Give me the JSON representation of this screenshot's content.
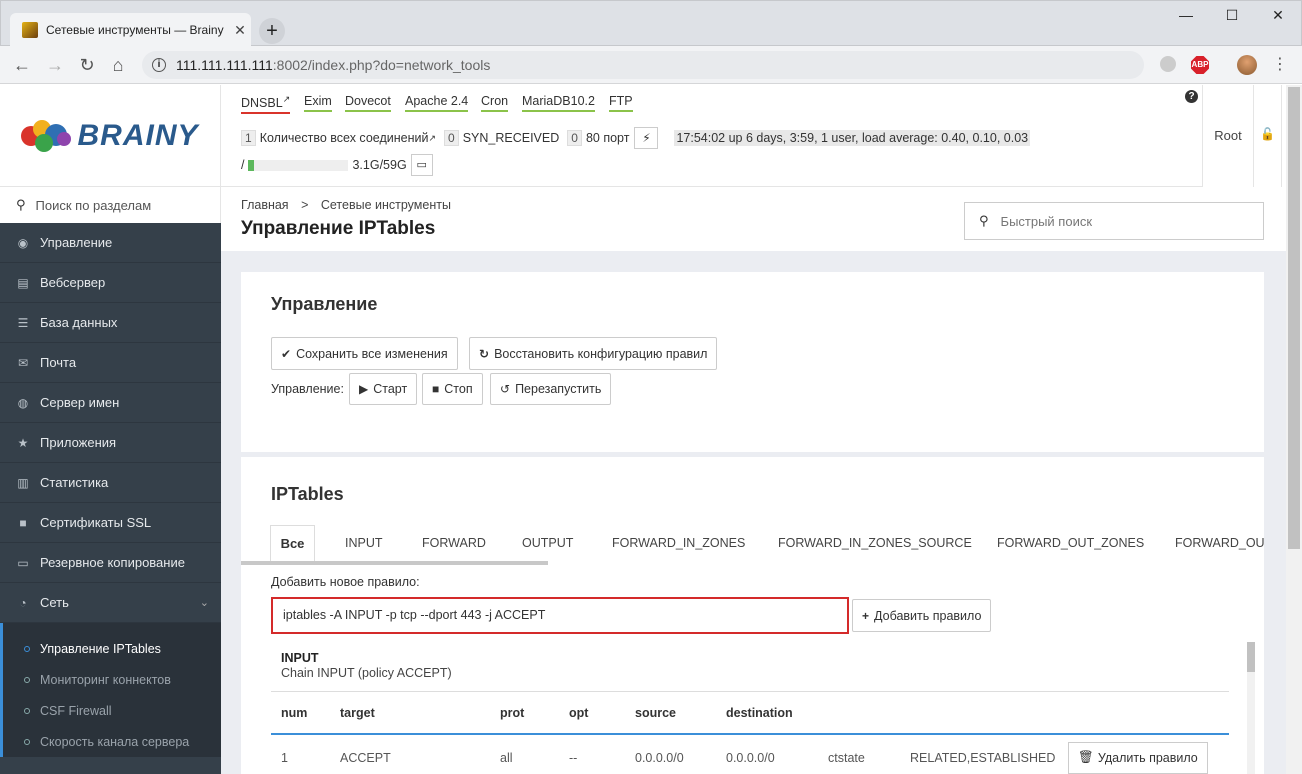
{
  "browser": {
    "tab_title": "Сетевые инструменты — Brainy",
    "tab_close": "✕",
    "new_tab": "+",
    "url_host": "111.111.111.111",
    "url_path": ":8002/index.php?do=network_tools",
    "abp_label": "ABP"
  },
  "logo": {
    "text": "BRAINY"
  },
  "services": [
    "DNSBL",
    "Exim",
    "Dovecot",
    "Apache 2.4",
    "Cron",
    "MariaDB10.2",
    "FTP"
  ],
  "stats": {
    "connections_count": "1",
    "connections_label": "Количество всех соединений",
    "syn_count": "0",
    "syn_label": "SYN_RECEIVED",
    "port_count": "0",
    "port_label": "80 порт",
    "uptime": "17:54:02 up 6 days, 3:59, 1 user, load average: 0.40, 0.10, 0.03",
    "disk_mount": "/",
    "disk_usage": "3.1G/59G",
    "disk_fraction": 0.053
  },
  "user": {
    "name": "Root"
  },
  "sidebar": {
    "search_placeholder": "Поиск по разделам",
    "items": [
      {
        "label": "Управление",
        "icon": "dashboard-icon"
      },
      {
        "label": "Вебсервер",
        "icon": "server-icon"
      },
      {
        "label": "База данных",
        "icon": "database-icon"
      },
      {
        "label": "Почта",
        "icon": "mail-icon"
      },
      {
        "label": "Сервер имен",
        "icon": "globe-icon"
      },
      {
        "label": "Приложения",
        "icon": "star-icon"
      },
      {
        "label": "Статистика",
        "icon": "bar-chart-icon"
      },
      {
        "label": "Сертификаты SSL",
        "icon": "lock-icon"
      },
      {
        "label": "Резервное копирование",
        "icon": "hdd-icon"
      },
      {
        "label": "Сеть",
        "icon": "rss-icon"
      }
    ],
    "subitems": [
      {
        "label": "Управление IPTables"
      },
      {
        "label": "Мониторинг коннектов"
      },
      {
        "label": "CSF Firewall"
      },
      {
        "label": "Скорость канала сервера"
      }
    ]
  },
  "breadcrumb": {
    "home": "Главная",
    "separator": ">",
    "current": "Сетевые инструменты"
  },
  "page_title": "Управление IPTables",
  "quick_search_placeholder": "Быстрый поиск",
  "manage_panel": {
    "title": "Управление",
    "save_label": "Сохранить все изменения",
    "restore_label": "Восстановить конфигурацию правил",
    "control_label": "Управление:",
    "start_label": "Старт",
    "stop_label": "Стоп",
    "restart_label": "Перезапустить"
  },
  "iptables_panel": {
    "title": "IPTables",
    "tabs": [
      "Все",
      "INPUT",
      "FORWARD",
      "OUTPUT",
      "FORWARD_IN_ZONES",
      "FORWARD_IN_ZONES_SOURCE",
      "FORWARD_OUT_ZONES",
      "FORWARD_OUT"
    ],
    "add_rule_label": "Добавить новое правило:",
    "add_rule_value": "iptables -A INPUT -p tcp --dport 443 -j ACCEPT",
    "add_rule_button": "Добавить правило",
    "chain_name": "INPUT",
    "chain_desc": "Chain INPUT (policy ACCEPT)",
    "columns": [
      "num",
      "target",
      "prot",
      "opt",
      "source",
      "destination"
    ],
    "rows": [
      {
        "num": "1",
        "target": "ACCEPT",
        "prot": "all",
        "opt": "--",
        "source": "0.0.0.0/0",
        "destination": "0.0.0.0/0",
        "extra1": "ctstate",
        "extra2": "RELATED,ESTABLISHED",
        "action": "Удалить правило"
      }
    ]
  }
}
